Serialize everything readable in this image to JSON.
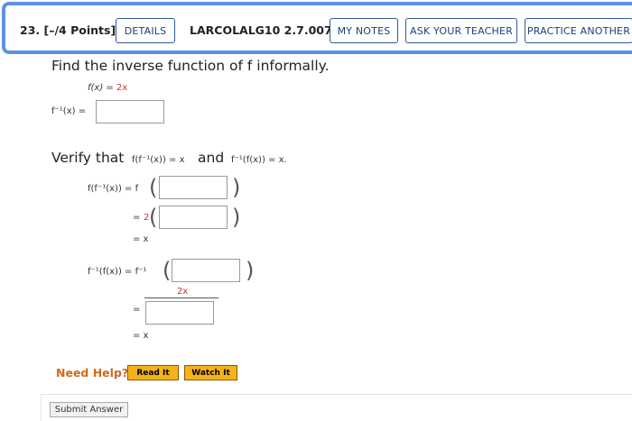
{
  "header": {
    "question_number": "23.",
    "points": "[–/4 Points]",
    "details_label": "DETAILS",
    "code": "LARCOLALG10 2.7.007.",
    "my_notes_label": "MY NOTES",
    "ask_teacher_label": "ASK YOUR TEACHER",
    "practice_label": "PRACTICE ANOTHER"
  },
  "problem": {
    "instruction": "Find the inverse function of f informally.",
    "fx_lhs": "f(x) = ",
    "fx_rhs": "2x",
    "finv_lhs": "f⁻¹(x) =",
    "verify_intro": "Verify that",
    "verify_eq1": "f(f⁻¹(x)) = x",
    "verify_and": "and",
    "verify_eq2": "f⁻¹(f(x)) = x.",
    "v1_line1_lhs": "f(f⁻¹(x)) = f",
    "v1_line2_lhs": "=",
    "v1_line2_coef": "2",
    "v1_line3": "= x",
    "v2_line1_lhs": "f⁻¹(f(x)) = f⁻¹",
    "v2_numerator": "2x",
    "v2_eq": "=",
    "v2_line3": "= x"
  },
  "help": {
    "need_help": "Need Help?",
    "read_it": "Read It",
    "watch_it": "Watch It"
  },
  "footer": {
    "submit_label": "Submit Answer"
  },
  "colors": {
    "header_border": "#5b93e0",
    "button_border": "#2d5aa0",
    "help_text": "#d2691e",
    "help_button": "#f5b21a",
    "accent_red": "#c0392b"
  }
}
